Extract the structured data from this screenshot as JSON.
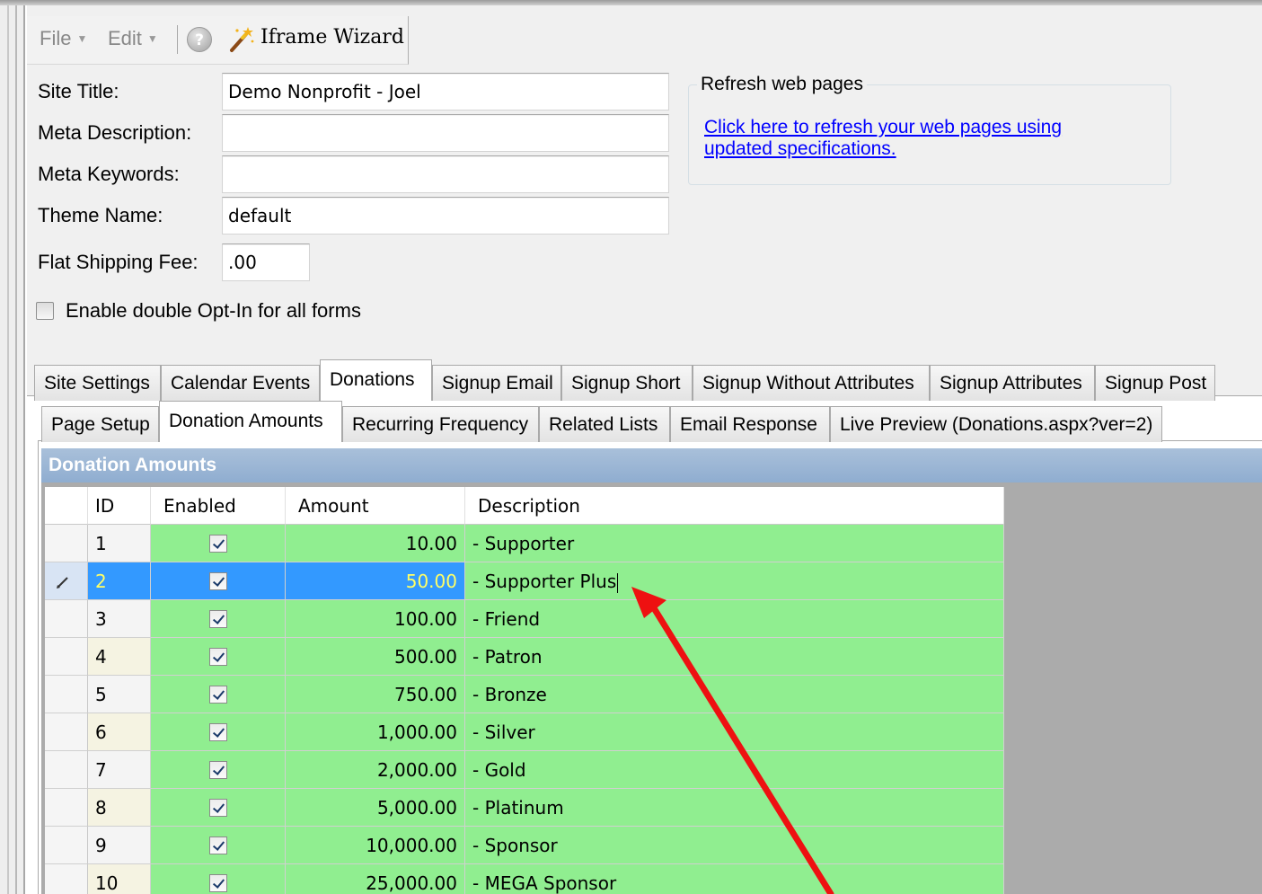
{
  "menu": {
    "file": "File",
    "edit": "Edit",
    "wizard": "Iframe Wizard"
  },
  "form": {
    "site_title_label": "Site Title:",
    "site_title_value": "Demo Nonprofit - Joel",
    "meta_description_label": "Meta Description:",
    "meta_description_value": "",
    "meta_keywords_label": "Meta Keywords:",
    "meta_keywords_value": "",
    "theme_name_label": "Theme Name:",
    "theme_name_value": "default",
    "flat_shipping_label": "Flat Shipping Fee:",
    "flat_shipping_value": ".00",
    "double_optin_label": "Enable double Opt-In for all forms",
    "double_optin_checked": false
  },
  "refresh": {
    "group_title": "Refresh web pages",
    "link_text": "Click here to refresh your web pages using updated specifications."
  },
  "main_tabs": [
    {
      "label": "Site Settings"
    },
    {
      "label": "Calendar Events"
    },
    {
      "label": "Donations"
    },
    {
      "label": "Signup Email"
    },
    {
      "label": "Signup Short"
    },
    {
      "label": "Signup Without Attributes"
    },
    {
      "label": "Signup Attributes"
    },
    {
      "label": "Signup Post"
    }
  ],
  "active_main_tab": "Donations",
  "sub_tabs": [
    {
      "label": "Page Setup"
    },
    {
      "label": "Donation Amounts"
    },
    {
      "label": "Recurring Frequency"
    },
    {
      "label": "Related Lists"
    },
    {
      "label": "Email Response"
    },
    {
      "label": "Live Preview (Donations.aspx?ver=2)"
    }
  ],
  "active_sub_tab": "Donation Amounts",
  "section_title": "Donation Amounts",
  "grid": {
    "columns": [
      "ID",
      "Enabled",
      "Amount",
      "Description"
    ],
    "rows": [
      {
        "id": "1",
        "enabled": true,
        "amount": "10.00",
        "description": "- Supporter"
      },
      {
        "id": "2",
        "enabled": true,
        "amount": "50.00",
        "description": "- Supporter Plus"
      },
      {
        "id": "3",
        "enabled": true,
        "amount": "100.00",
        "description": "- Friend"
      },
      {
        "id": "4",
        "enabled": true,
        "amount": "500.00",
        "description": "- Patron"
      },
      {
        "id": "5",
        "enabled": true,
        "amount": "750.00",
        "description": "- Bronze"
      },
      {
        "id": "6",
        "enabled": true,
        "amount": "1,000.00",
        "description": "- Silver"
      },
      {
        "id": "7",
        "enabled": true,
        "amount": "2,000.00",
        "description": "- Gold"
      },
      {
        "id": "8",
        "enabled": true,
        "amount": "5,000.00",
        "description": "- Platinum"
      },
      {
        "id": "9",
        "enabled": true,
        "amount": "10,000.00",
        "description": "- Sponsor"
      },
      {
        "id": "10",
        "enabled": true,
        "amount": "25,000.00",
        "description": "- MEGA Sponsor"
      }
    ],
    "editing_row_index": 1
  },
  "colors": {
    "row_green": "#90ee90",
    "selection_blue": "#3399ff",
    "selection_text": "#ffff66",
    "header_blue": "#9bb6d6",
    "annotation_arrow": "#ee1111"
  }
}
